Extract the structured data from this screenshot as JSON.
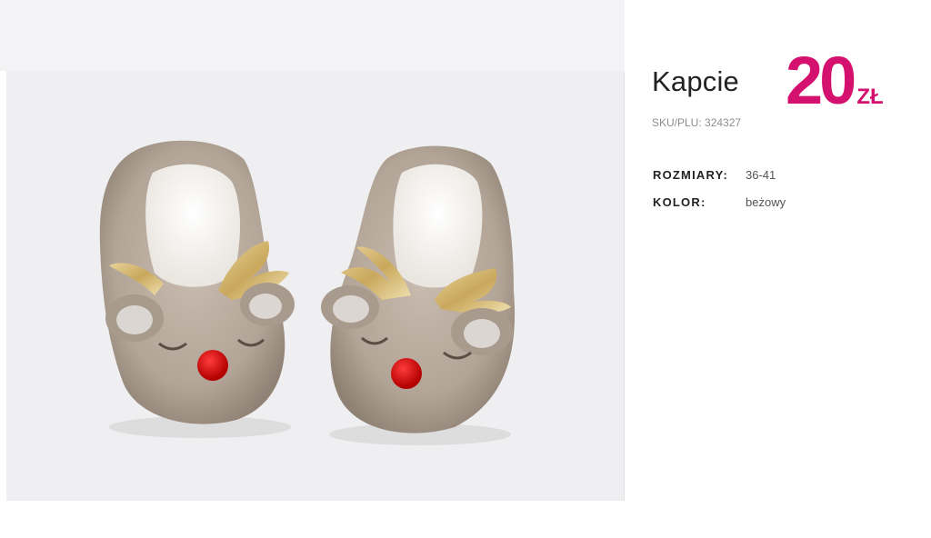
{
  "product": {
    "title": "Kapcie",
    "sku": "SKU/PLU: 324327",
    "price_amount": "20",
    "price_currency": "ZŁ",
    "image_alt": "Kapcie renifery – beżowe pluszowe kapcie z rogami i czerwonym nosem"
  },
  "attributes": [
    {
      "label": "ROZMIARY:",
      "value": "36-41"
    },
    {
      "label": "KOLOR:",
      "value": "beżowy"
    }
  ],
  "colors": {
    "accent": "#d4116e",
    "title": "#222222",
    "muted": "#8d8d8d"
  }
}
